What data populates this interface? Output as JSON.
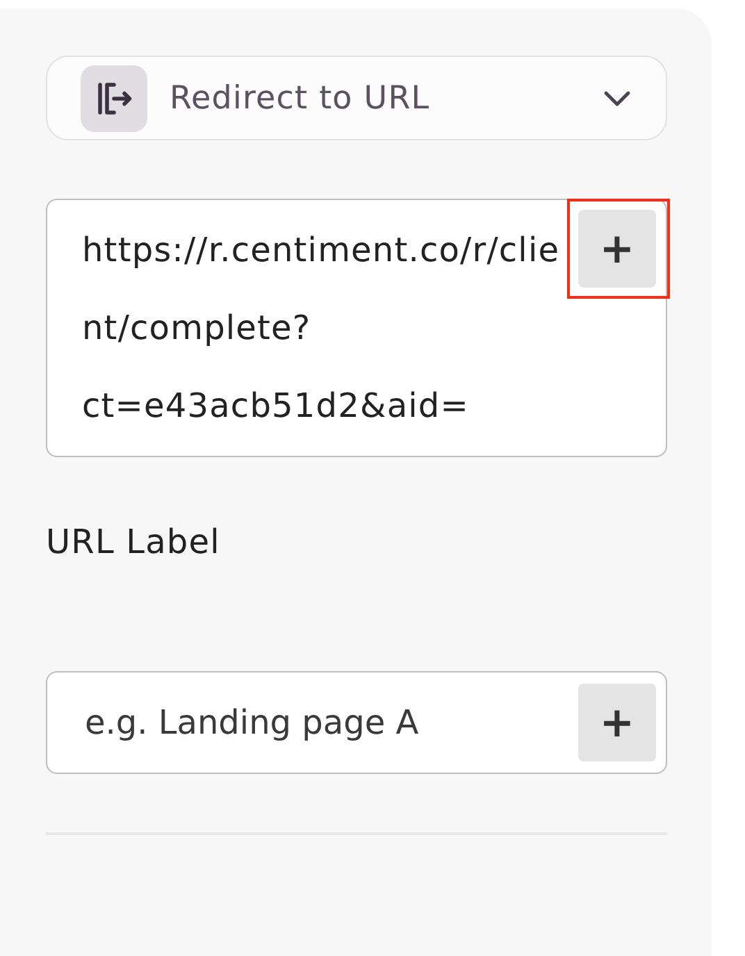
{
  "action_select": {
    "label": "Redirect to URL",
    "expanded": false
  },
  "url_field": {
    "value_lines": [
      "https://r.centiment.co/r/clie",
      "nt/complete?",
      "ct=e43acb51d2&aid="
    ],
    "insert_button": {
      "label": "+",
      "highlighted": true
    }
  },
  "url_label": {
    "title": "URL Label",
    "placeholder": "e.g. Landing page A",
    "insert_button": {
      "label": "+",
      "highlighted": false
    }
  }
}
